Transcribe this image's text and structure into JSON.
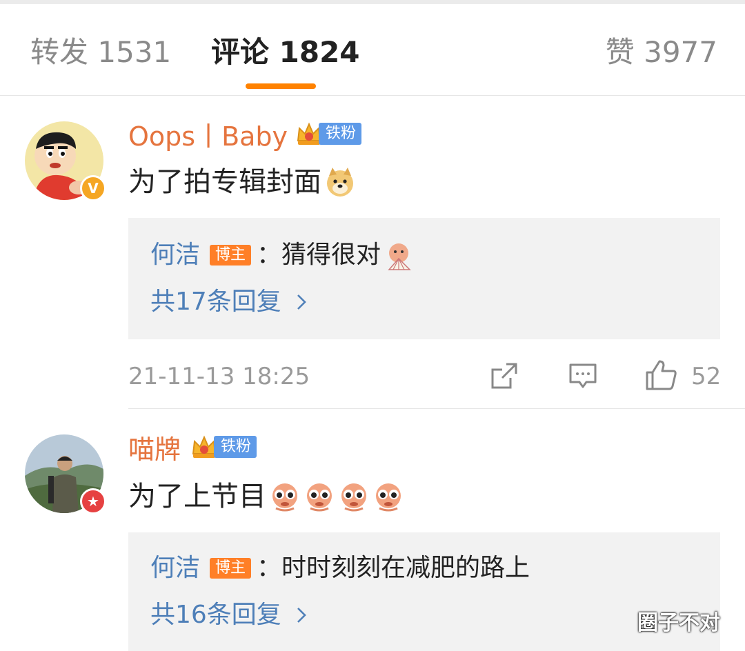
{
  "tabs": {
    "repost": "转发 1531",
    "comment": "评论 1824",
    "like": "赞 3977"
  },
  "comments": [
    {
      "username": "Oops丨Baby",
      "fan_badge": "铁粉",
      "text": "为了拍专辑封面",
      "emoji": [
        "doge-emoji"
      ],
      "reply": {
        "author": "何洁",
        "host_badge": "博主",
        "text": "：猜得很对",
        "emoji": [
          "fan-emoji"
        ]
      },
      "more_replies": "共17条回复",
      "timestamp": "21-11-13 18:25",
      "like_count": "52"
    },
    {
      "username": "喵牌",
      "fan_badge": "铁粉",
      "text": "为了上节目",
      "emoji": [
        "eyes-emoji",
        "eyes-emoji",
        "eyes-emoji",
        "eyes-emoji"
      ],
      "reply": {
        "author": "何洁",
        "host_badge": "博主",
        "text": "：时时刻刻在减肥的路上"
      },
      "more_replies": "共16条回复"
    }
  ],
  "watermark": "圈子不对",
  "colors": {
    "accent": "#ff8200",
    "username": "#e5743e",
    "link": "#4e7fb8",
    "fan_tag": "#5e9ae8",
    "host_tag": "#ff7f27"
  }
}
